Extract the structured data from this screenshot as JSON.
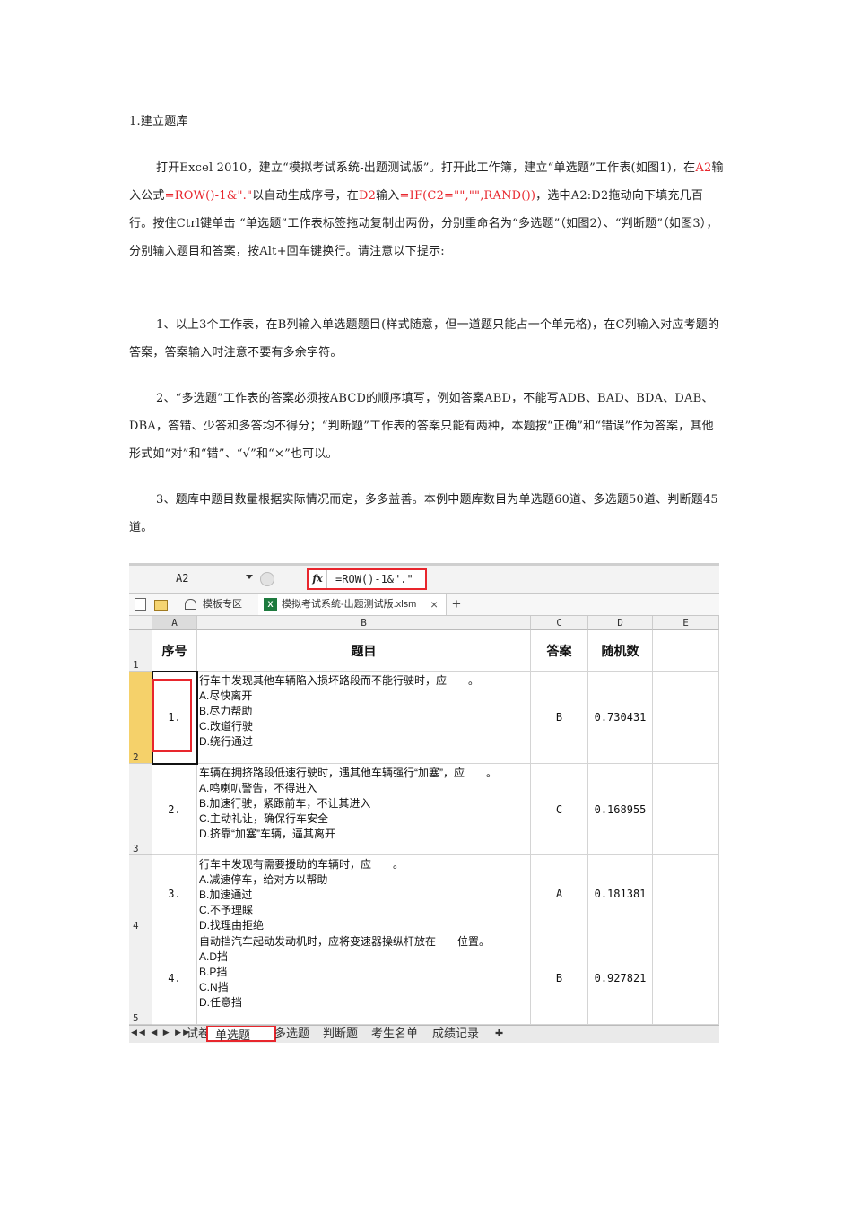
{
  "heading": "1.建立题库",
  "paragraphs": {
    "p1_a": "打开Excel 2010，建立“模拟考试系统-出题测试版”。打开此工作簿，建立“单选题”工作表(如图1)，在",
    "p1_b": "A2",
    "p1_c": "输入公式",
    "p1_d": "=ROW()-1&\".\"",
    "p1_e": "以自动生成序号，在",
    "p1_f": "D2",
    "p1_g": "输入",
    "p1_h": "=IF(C2=\"\",\"\",RAND())",
    "p1_i": "，选中A2:D2拖动向下填充几百行。按住Ctrl键单击 “单选题”工作表标签拖动复制出两份，分别重命名为“多选题”（如图2）、“判断题”（如图3），分别输入题目和答案，按Alt+回车键换行。请注意以下提示:",
    "p2": "1、以上3个工作表，在B列输入单选题题目(样式随意，但一道题只能占一个单元格)，在C列输入对应考题的答案，答案输入时注意不要有多余字符。",
    "p3": "2、“多选题”工作表的答案必须按ABCD的顺序填写，例如答案ABD，不能写ADB、BAD、BDA、DAB、DBA，答错、少答和多答均不得分；“判断题”工作表的答案只能有两种，本题按“正确”和“错误”作为答案，其他形式如“对”和“错”、“√”和“×”也可以。",
    "p4": "3、题库中题目数量根据实际情况而定，多多益善。本例中题库数目为单选题60道、多选题50道、判断题45道。"
  },
  "excel": {
    "name_box": "A2",
    "fx": "fx",
    "formula": "=ROW()-1&\".\"",
    "tabs": {
      "templates": "模板专区",
      "file": "模拟考试系统-出题测试版.xlsm",
      "close": "×",
      "new": "+"
    },
    "columns": [
      "A",
      "B",
      "C",
      "D",
      "E"
    ],
    "header": {
      "seq": "序号",
      "question": "题目",
      "answer": "答案",
      "random": "随机数"
    },
    "rows": [
      {
        "rownum": "2",
        "seq": "1.",
        "question": "行车中发现其他车辆陷入损坏路段而不能行驶时，应　　。\nA.尽快离开\nB.尽力帮助\nC.改道行驶\nD.绕行通过",
        "answer": "B",
        "random": "0.730431"
      },
      {
        "rownum": "3",
        "seq": "2.",
        "question": "车辆在拥挤路段低速行驶时，遇其他车辆强行“加塞”，应　　。\nA.鸣喇叭警告，不得进入\nB.加速行驶，紧跟前车，不让其进入\nC.主动礼让，确保行车安全\nD.挤靠“加塞”车辆，逼其离开",
        "answer": "C",
        "random": "0.168955"
      },
      {
        "rownum": "4",
        "seq": "3.",
        "question": "行车中发现有需要援助的车辆时，应　　。\nA.减速停车，给对方以帮助\nB.加速通过\nC.不予理睬\nD.找理由拒绝",
        "answer": "A",
        "random": "0.181381"
      },
      {
        "rownum": "5",
        "seq": "4.",
        "question": "自动挡汽车起动发动机时，应将变速器操纵杆放在　　位置。\nA.D挡\nB.P挡\nC.N挡\nD.任意挡",
        "answer": "B",
        "random": "0.927821"
      }
    ],
    "header_rownum": "1",
    "sheets": [
      "试卷",
      "单选题",
      "多选题",
      "判断题",
      "考生名单",
      "成绩记录"
    ],
    "active_sheet": "单选题"
  }
}
